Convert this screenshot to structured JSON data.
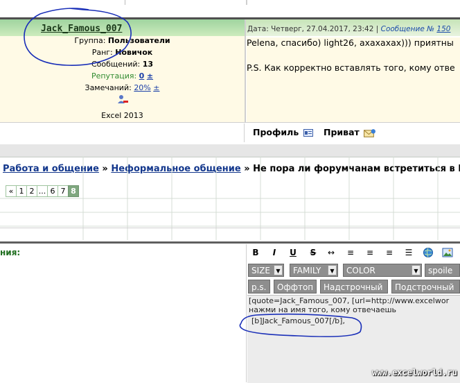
{
  "post": {
    "username": "Jack_Famous_007",
    "date_label": "Дата: Четверг, 27.04.2017, 23:42 |",
    "msg_label": "Сообщение №",
    "msg_number": "150",
    "user": {
      "group_label": "Группа:",
      "group_value": "Пользователи",
      "rank_label": "Ранг:",
      "rank_value": "Новичок",
      "messages_label": "Сообщений:",
      "messages_value": "13",
      "reputation_label": "Репутация:",
      "reputation_value": "0",
      "reputation_pm": "±",
      "warnings_label": "Замечаний:",
      "warnings_value": "20%",
      "warnings_pm": "±",
      "software": "Excel 2013"
    },
    "text_line1": "Pelena, спасибо) light26, ахахахах))) приятны",
    "text_line2": "P.S. Как корректно вставлять того, кому отве",
    "profile_button": "Профиль",
    "private_button": "Приват"
  },
  "breadcrumb": {
    "item1": "Работа и общение",
    "sep": "»",
    "item2": "Неформальное общение",
    "item3": "Не пора ли форумчанам встретиться в П"
  },
  "pager": [
    "«",
    "1",
    "2",
    "...",
    "6",
    "7",
    "8"
  ],
  "pager_current": "8",
  "reply": {
    "label": "ния:",
    "toolbar": [
      "B",
      "I",
      "U",
      "S",
      "↔",
      "≡",
      "≡",
      "≡",
      "☰"
    ],
    "size": "SIZE",
    "family": "FAMILY",
    "color": "COLOR",
    "spoiler": "spoile",
    "ps": "p.s.",
    "offtop": "Оффтоп",
    "superscript": "Надстрочный",
    "subscript": "Подстрочный",
    "text_line1": "[quote=Jack_Famous_007, [url=http://www.excelwor",
    "text_line2": "нажми на имя того, кому отвечаешь",
    "text_line3": "[b]Jack_Famous_007[/b],"
  },
  "watermark": "www.excelworld.ru",
  "colors": {
    "header_green": "#9fd49f",
    "user_bg": "#fffae6",
    "link_blue": "#13378c",
    "reputation_green": "#2f8a2f",
    "pen_blue": "#1a2fb8"
  }
}
